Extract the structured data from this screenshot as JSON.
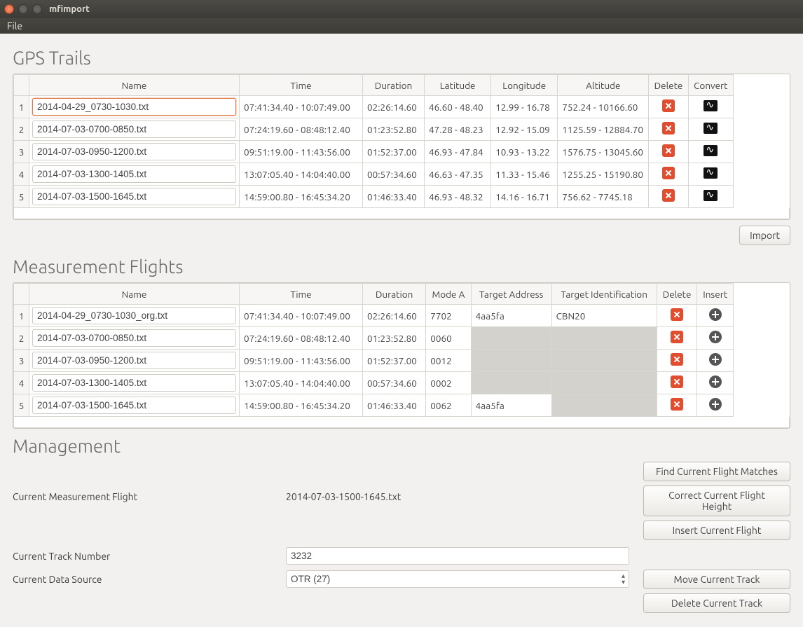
{
  "window": {
    "title": "mfimport"
  },
  "menu": {
    "file": "File"
  },
  "sections": {
    "gps_title": "GPS Trails",
    "flights_title": "Measurement Flights",
    "mgmt_title": "Management"
  },
  "gps": {
    "headers": {
      "name": "Name",
      "time": "Time",
      "duration": "Duration",
      "lat": "Latitude",
      "lon": "Longitude",
      "alt": "Altitude",
      "delete": "Delete",
      "convert": "Convert"
    },
    "rows": [
      {
        "n": "1",
        "name": "2014-04-29_0730-1030.txt",
        "time": "07:41:34.40 - 10:07:49.00",
        "dur": "02:26:14.60",
        "lat": "46.60 - 48.40",
        "lon": "12.99 - 16.78",
        "alt": "752.24 - 10166.60",
        "selected": true
      },
      {
        "n": "2",
        "name": "2014-07-03-0700-0850.txt",
        "time": "07:24:19.60 - 08:48:12.40",
        "dur": "01:23:52.80",
        "lat": "47.28 - 48.23",
        "lon": "12.92 - 15.09",
        "alt": "1125.59 - 12884.70"
      },
      {
        "n": "3",
        "name": "2014-07-03-0950-1200.txt",
        "time": "09:51:19.00 - 11:43:56.00",
        "dur": "01:52:37.00",
        "lat": "46.93 - 47.84",
        "lon": "10.93 - 13.22",
        "alt": "1576.75 - 13045.60"
      },
      {
        "n": "4",
        "name": "2014-07-03-1300-1405.txt",
        "time": "13:07:05.40 - 14:04:40.00",
        "dur": "00:57:34.60",
        "lat": "46.63 - 47.35",
        "lon": "11.33 - 15.46",
        "alt": "1255.25 - 15190.80"
      },
      {
        "n": "5",
        "name": "2014-07-03-1500-1645.txt",
        "time": "14:59:00.80 - 16:45:34.20",
        "dur": "01:46:33.40",
        "lat": "46.93 - 48.32",
        "lon": "14.16 - 16.71",
        "alt": "756.62 - 7745.18"
      }
    ],
    "import_btn": "Import"
  },
  "flights": {
    "headers": {
      "name": "Name",
      "time": "Time",
      "duration": "Duration",
      "modea": "Mode A",
      "taddr": "Target Address",
      "tid": "Target Identification",
      "delete": "Delete",
      "insert": "Insert"
    },
    "rows": [
      {
        "n": "1",
        "name": "2014-04-29_0730-1030_org.txt",
        "time": "07:41:34.40 - 10:07:49.00",
        "dur": "02:26:14.60",
        "modea": "7702",
        "taddr": "4aa5fa",
        "tid": "CBN20"
      },
      {
        "n": "2",
        "name": "2014-07-03-0700-0850.txt",
        "time": "07:24:19.60 - 08:48:12.40",
        "dur": "01:23:52.80",
        "modea": "0060",
        "taddr": "",
        "tid": ""
      },
      {
        "n": "3",
        "name": "2014-07-03-0950-1200.txt",
        "time": "09:51:19.00 - 11:43:56.00",
        "dur": "01:52:37.00",
        "modea": "0012",
        "taddr": "",
        "tid": ""
      },
      {
        "n": "4",
        "name": "2014-07-03-1300-1405.txt",
        "time": "13:07:05.40 - 14:04:40.00",
        "dur": "00:57:34.60",
        "modea": "0002",
        "taddr": "",
        "tid": ""
      },
      {
        "n": "5",
        "name": "2014-07-03-1500-1645.txt",
        "time": "14:59:00.80 - 16:45:34.20",
        "dur": "01:46:33.40",
        "modea": "0062",
        "taddr": "4aa5fa",
        "tid": ""
      }
    ]
  },
  "mgmt": {
    "cmf_label": "Current Measurement Flight",
    "cmf_value": "2014-07-03-1500-1645.txt",
    "ctn_label": "Current Track Number",
    "ctn_value": "3232",
    "cds_label": "Current Data Source",
    "cds_value": "OTR (27)",
    "btns": {
      "find": "Find Current Flight Matches",
      "correct": "Correct Current Flight Height",
      "insert": "Insert Current Flight",
      "move": "Move Current Track",
      "delete": "Delete Current Track"
    }
  }
}
